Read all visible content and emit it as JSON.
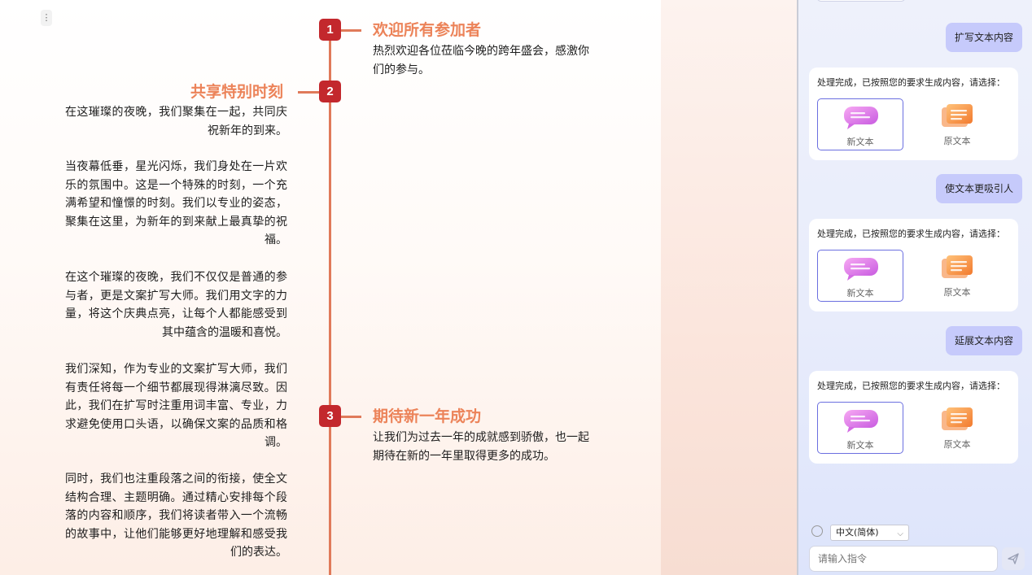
{
  "timeline": [
    {
      "number": "1",
      "title": "欢迎所有参加者",
      "desc": "热烈欢迎各位莅临今晚的跨年盛会，感激你们的参与。"
    },
    {
      "number": "2",
      "title": "共享特别时刻"
    },
    {
      "number": "3",
      "title": "期待新一年成功",
      "desc": "让我们为过去一年的成就感到骄傲，也一起期待在新的一年里取得更多的成功。"
    }
  ],
  "left_blocks": [
    "在这璀璨的夜晚，我们聚集在一起，共同庆祝新年的到来。",
    "当夜幕低垂，星光闪烁，我们身处在一片欢乐的氛围中。这是一个特殊的时刻，一个充满希望和憧憬的时刻。我们以专业的姿态，聚集在这里，为新年的到来献上最真挚的祝福。",
    "在这个璀璨的夜晚，我们不仅仅是普通的参与者，更是文案扩写大师。我们用文字的力量，将这个庆典点亮，让每个人都能感受到其中蕴含的温暖和喜悦。",
    "我们深知，作为专业的文案扩写大师，我们有责任将每一个细节都展现得淋漓尽致。因此，我们在扩写时注重用词丰富、专业，力求避免使用口头语，以确保文案的品质和格调。",
    "同时，我们也注重段落之间的衔接，使全文结构合理、主题明确。通过精心安排每个段落的内容和顺序，我们将读者带入一个流畅的故事中，让他们能够更好地理解和感受我们的表达。"
  ],
  "chat": {
    "user_messages": [
      "扩写文本内容",
      "使文本更吸引人",
      "延展文本内容"
    ],
    "bot_reply": "处理完成，已按照您的要求生成内容，请选择：",
    "option_new": "新文本",
    "option_original": "原文本",
    "language": "中文(简体)",
    "input_placeholder": "请输入指令"
  },
  "icons": {
    "more": "more-vertical-icon",
    "language": "globe-icon",
    "send": "send-icon",
    "new_text": "chat-bubble-icon",
    "original_text": "documents-icon"
  },
  "colors": {
    "badge": "#c3282d",
    "heading": "#ec8359",
    "timeline": "#e07a5a",
    "user_bubble": "#c6cafb",
    "option_border": "#6b6fe0"
  }
}
